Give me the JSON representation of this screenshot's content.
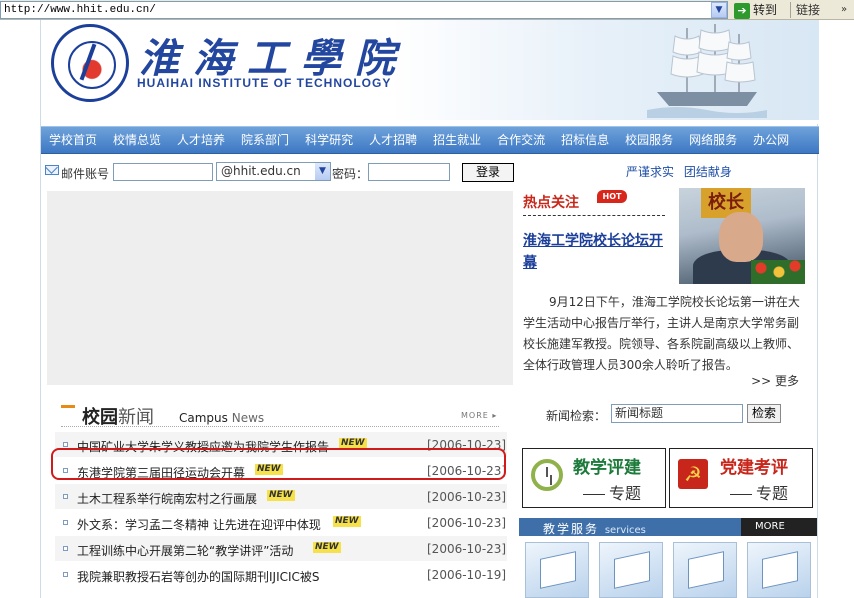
{
  "browser": {
    "address": "http://www.hhit.edu.cn/",
    "go_label": "转到",
    "links_label": "链接"
  },
  "header": {
    "title_cn": "淮海工學院",
    "title_en": "HUAIHAI INSTITUTE OF TECHNOLOGY"
  },
  "nav": {
    "items": [
      "学校首页",
      "校情总览",
      "人才培养",
      "院系部门",
      "科学研究",
      "人才招聘",
      "招生就业",
      "合作交流",
      "招标信息",
      "校园服务",
      "网络服务",
      "办公网"
    ]
  },
  "login": {
    "account_label": "邮件账号",
    "domain_value": "@hhit.edu.cn",
    "password_label": "密码：",
    "submit_label": "登录"
  },
  "motto": "严谨求实 团结献身",
  "hot": {
    "title": "热点关注",
    "badge": "HOT",
    "photo_sign": "校长",
    "headline": "淮海工学院校长论坛开幕",
    "body": "9月12日下午，淮海工学院校长论坛第一讲在大学生活动中心报告厅举行，主讲人是南京大学常务副校长施建军教授。院领导、各系院副高级以上教师、全体行政管理人员300余人聆听了报告。",
    "more": ">> 更多"
  },
  "campus_news": {
    "title_a": "校园",
    "title_b": "新闻",
    "title_en_a": "Campus",
    "title_en_b": "News",
    "more": "MORE",
    "items": [
      {
        "text": "中国矿业大学朱学义教授应邀为我院学生作报告",
        "new": "NEW",
        "date": "[2006-10-23]"
      },
      {
        "text": "东港学院第三届田径运动会开幕",
        "new": "NEW",
        "date": "[2006-10-23]"
      },
      {
        "text": "土木工程系举行皖南宏村之行画展",
        "new": "NEW",
        "date": "[2006-10-23]"
      },
      {
        "text": "外文系：学习孟二冬精神 让先进在迎评中体现",
        "new": "NEW",
        "date": "[2006-10-23]"
      },
      {
        "text": "工程训练中心开展第二轮“教学讲评”活动",
        "new": "NEW",
        "date": "[2006-10-23]"
      },
      {
        "text": "我院兼职教授石岩等创办的国际期刊IJICIC被S",
        "new": "",
        "date": "[2006-10-19]"
      }
    ]
  },
  "search": {
    "label": "新闻检索：",
    "value": "新闻标题",
    "button": "检索"
  },
  "promos": [
    {
      "title": "教学评建",
      "sub": "专题",
      "color": "#1c7a3a"
    },
    {
      "title": "党建考评",
      "sub": "专题",
      "color": "#c8261b"
    }
  ],
  "services": {
    "title": "教学服务",
    "title_en": "services",
    "more": "MORE"
  }
}
